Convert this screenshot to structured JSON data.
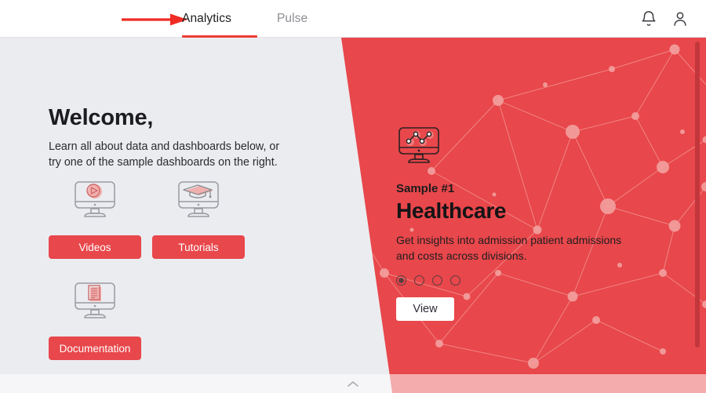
{
  "topbar": {
    "tabs": [
      {
        "label": "Analytics",
        "active": true
      },
      {
        "label": "Pulse",
        "active": false
      }
    ],
    "notifications_icon": "bell-icon",
    "account_icon": "user-avatar-icon",
    "annotation_arrow": "red-arrow-annotation"
  },
  "welcome": {
    "heading": "Welcome,",
    "line1": "Learn all about data and dashboards below, or",
    "line2": "try one of the sample dashboards on the right."
  },
  "resources": [
    {
      "label": "Videos",
      "icon": "monitor-play-icon"
    },
    {
      "label": "Tutorials",
      "icon": "monitor-graduation-cap-icon"
    },
    {
      "label": "Documentation",
      "icon": "monitor-document-icon"
    }
  ],
  "sample": {
    "icon": "monitor-scatter-chart-icon",
    "eyebrow": "Sample #1",
    "title": "Healthcare",
    "desc_line1": "Get insights into admission patient admissions",
    "desc_line2": "and costs across divisions.",
    "view_label": "View",
    "carousel": {
      "count": 4,
      "active_index": 0
    }
  },
  "bottombar": {
    "collapse_icon": "chevron-up-icon"
  },
  "colors": {
    "brand_red": "#e8474b",
    "accent_red": "#ee3b33",
    "panel_bg": "#ebecf0",
    "scrollbar": "#c2373b",
    "text_dark": "#1c1c1e",
    "text_muted": "#8d8d93"
  }
}
